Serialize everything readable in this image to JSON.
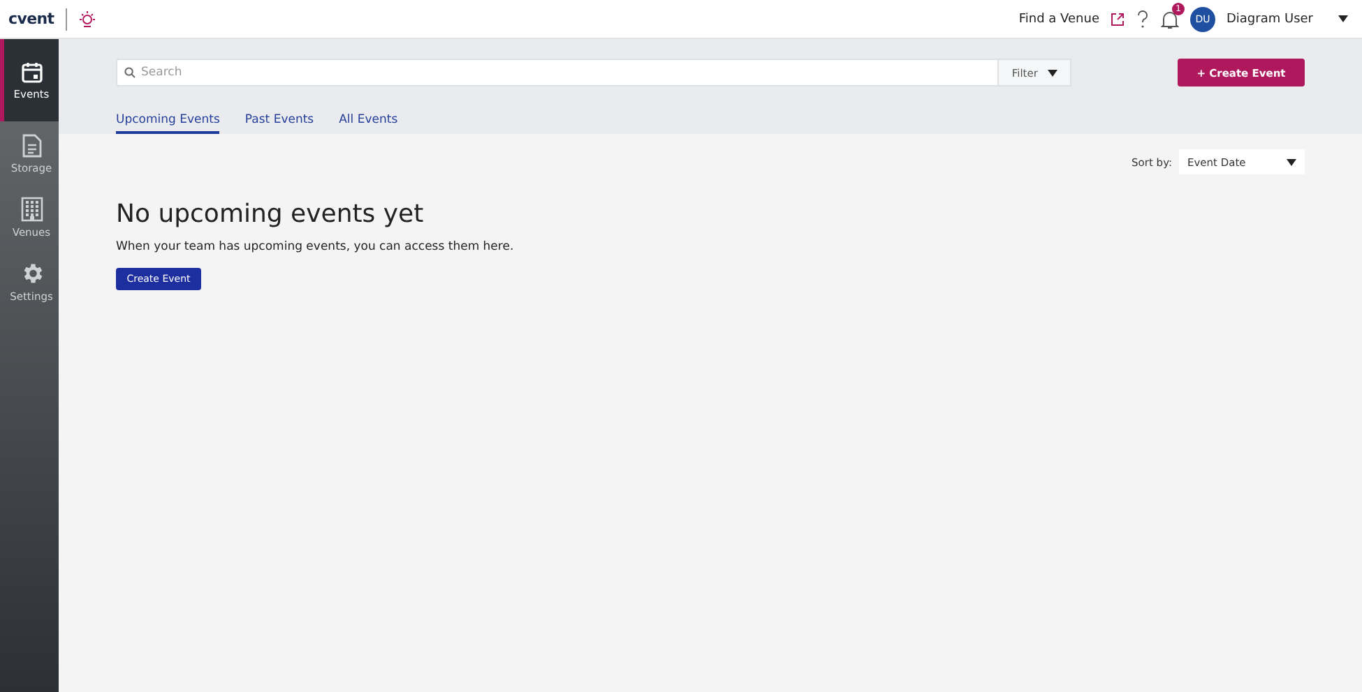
{
  "header": {
    "logo": "cvent",
    "find_venue": "Find a Venue",
    "notification_count": "1",
    "user_initials": "DU",
    "user_name": "Diagram User"
  },
  "sidebar": {
    "items": [
      {
        "label": "Events",
        "kind": "calendar",
        "selected": true
      },
      {
        "label": "Storage",
        "kind": "document",
        "selected": false
      },
      {
        "label": "Venues",
        "kind": "building",
        "selected": false
      },
      {
        "label": "Settings",
        "kind": "gear",
        "selected": false
      }
    ]
  },
  "search": {
    "placeholder": "Search"
  },
  "filter": "Filter",
  "create_button": "+ Create Event",
  "tabs": [
    {
      "label": "Upcoming Events",
      "selected": true
    },
    {
      "label": "Past Events",
      "selected": false
    },
    {
      "label": "All Events",
      "selected": false
    }
  ],
  "sort": {
    "label": "Sort by:",
    "value": "Event Date"
  },
  "empty": {
    "title": "No upcoming events yet",
    "message": "When your team has upcoming events, you can access them here.",
    "button": "Create Event"
  }
}
